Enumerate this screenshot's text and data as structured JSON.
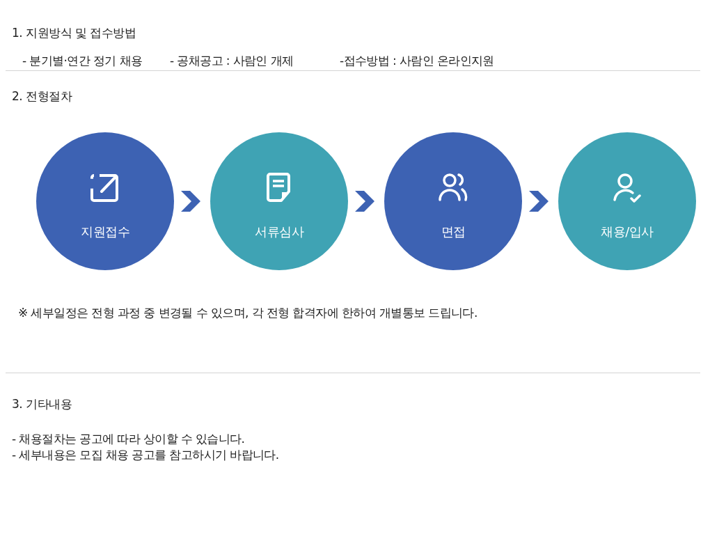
{
  "sections": [
    {
      "title": "1. 지원방식 및 접수방법",
      "kind": "inline",
      "items": [
        "- 분기별·연간 정기 채용",
        "- 공채공고 : 사람인 개제",
        "-접수방법 : 사람인 온라인지원"
      ]
    },
    {
      "title": "2. 전형절차",
      "kind": "steps",
      "steps": [
        {
          "label": "지원접수",
          "kind": "edit",
          "color": "#3d62b3"
        },
        {
          "label": "서류심사",
          "kind": "document",
          "color": "#3fa3b4"
        },
        {
          "label": "면접",
          "kind": "people",
          "color": "#3d62b3"
        },
        {
          "label": "채용/입사",
          "kind": "user-check",
          "color": "#3fa3b4"
        }
      ],
      "note": "※ 세부일정은 전형 과정 중 변경될 수 있으며, 각 전형  합격자에 한하여 개별통보 드립니다."
    },
    {
      "title": "3. 기타내용",
      "kind": "lines",
      "items": [
        "- 채용절차는 공고에 따라 상이할 수 있습니다.",
        "- 세부내용은 모집 채용 공고를 참고하시기 바랍니다."
      ]
    }
  ]
}
